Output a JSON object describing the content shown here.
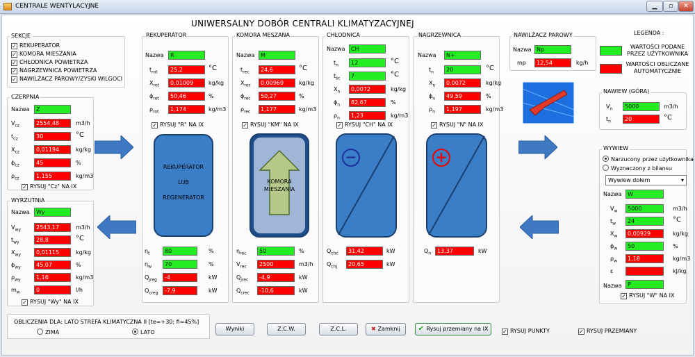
{
  "window": {
    "title": "CENTRALE WENTYLACYJNE",
    "min": "▁",
    "max": "▫",
    "close": "✕"
  },
  "main_title": "UNIWERSALNY DOBÓR CENTRALI KLIMATYZACYJNEJ",
  "sekcje": {
    "title": "SEKCJE",
    "items": [
      "REKUPERATOR",
      "KOMORA MIESZANIA",
      "CHŁODNICA POWIETRZA",
      "NAGRZEWNICA POWIETRZA",
      "NAWILŻACZ PAROWY/ZYSKI WILGOCI"
    ]
  },
  "czerpnia": {
    "title": "CZERPNIA",
    "nazwa_label": "Nazwa",
    "nazwa": "Z",
    "rows": [
      {
        "l": "V",
        "s": "cz",
        "v": "2554,48",
        "u": "m3/h"
      },
      {
        "l": "t",
        "s": "cz",
        "v": "30",
        "u": "°C"
      },
      {
        "l": "X",
        "s": "cz",
        "v": "0,01194",
        "u": "kg/kg"
      },
      {
        "l": "ϕ",
        "s": "cz",
        "v": "45",
        "u": "%"
      },
      {
        "l": "ρ",
        "s": "cz",
        "v": "1,155",
        "u": "kg/m3"
      }
    ],
    "check": "RYSUJ \"Cz\" NA IX"
  },
  "wyrzutnia": {
    "title": "WYRZUTNIA",
    "nazwa_label": "Nazwa",
    "nazwa": "Wy",
    "rows": [
      {
        "l": "V",
        "s": "wy",
        "v": "2543,17",
        "u": "m3/h"
      },
      {
        "l": "t",
        "s": "wy",
        "v": "28,8",
        "u": "°C"
      },
      {
        "l": "X",
        "s": "wy",
        "v": "0,01115",
        "u": "kg/kg"
      },
      {
        "l": "ϕ",
        "s": "wy",
        "v": "45,07",
        "u": "%"
      },
      {
        "l": "ρ",
        "s": "wy",
        "v": "1,16",
        "u": "kg/m3"
      },
      {
        "l": "m",
        "s": "w",
        "v": "0",
        "u": "l/h"
      }
    ],
    "check": "RYSUJ \"Wy\" NA IX"
  },
  "rekuperator": {
    "title": "REKUPERATOR",
    "nazwa_label": "Nazwa",
    "nazwa": "R",
    "rows": [
      {
        "l": "t",
        "s": "rot",
        "v": "25,2",
        "u": "°C"
      },
      {
        "l": "X",
        "s": "rot",
        "v": "0,01009",
        "u": "kg/kg"
      },
      {
        "l": "ϕ",
        "s": "rot",
        "v": "50,46",
        "u": "%"
      },
      {
        "l": "ρ",
        "s": "rot",
        "v": "1,174",
        "u": "kg/m3"
      }
    ],
    "check": "RYSUJ \"R\" NA IX",
    "device": [
      "REKUPERATOR",
      "LUB",
      "REGENERATOR"
    ],
    "bottom": [
      {
        "l": "η",
        "s": "t",
        "v": "80",
        "u": "%",
        "c": "g"
      },
      {
        "l": "η",
        "s": "w",
        "v": "70",
        "u": "%",
        "c": "g"
      },
      {
        "l": "Q",
        "s": "jreg",
        "v": "-4",
        "u": "kW",
        "c": "r"
      },
      {
        "l": "Q",
        "s": "creg",
        "v": "-7,9",
        "u": "kW",
        "c": "r"
      }
    ]
  },
  "komora": {
    "title": "KOMORA MESZANA",
    "nazwa_label": "Nazwa",
    "nazwa": "M",
    "rows": [
      {
        "l": "t",
        "s": "rec",
        "v": "24,6",
        "u": "°C"
      },
      {
        "l": "X",
        "s": "rec",
        "v": "0,00969",
        "u": "kg/kg"
      },
      {
        "l": "ϕ",
        "s": "rec",
        "v": "50,27",
        "u": "%"
      },
      {
        "l": "ρ",
        "s": "rec",
        "v": "1,177",
        "u": "kg/m3"
      }
    ],
    "check": "RYSUJ \"KM\" NA IX",
    "device": [
      "KOMORA",
      "MIESZANIA"
    ],
    "bottom": [
      {
        "l": "η",
        "s": "rec",
        "v": "50",
        "u": "%",
        "c": "g"
      },
      {
        "l": "V",
        "s": "rec",
        "v": "2500",
        "u": "m3/h",
        "c": "r"
      },
      {
        "l": "Q",
        "s": "jrec",
        "v": "-4,9",
        "u": "kW",
        "c": "r"
      },
      {
        "l": "Q",
        "s": "crec",
        "v": "-10,6",
        "u": "kW",
        "c": "r"
      }
    ]
  },
  "chlodnica": {
    "title": "CHŁODNICA",
    "nazwa_label": "Nazwa",
    "nazwa": "CH",
    "rows": [
      {
        "l": "t",
        "s": "n",
        "v": "12",
        "u": "°C",
        "c": "g"
      },
      {
        "l": "t",
        "s": "śc",
        "v": "7",
        "u": "°C",
        "c": "g"
      },
      {
        "l": "X",
        "s": "n",
        "v": "0,0072",
        "u": "kg/kg",
        "c": "r"
      },
      {
        "l": "ϕ",
        "s": "n",
        "v": "82,67",
        "u": "%",
        "c": "r"
      },
      {
        "l": "ρ",
        "s": "n",
        "v": "1,23",
        "u": "kg/m3",
        "c": "r"
      }
    ],
    "check": "RYSUJ \"CH\" NA IX",
    "symbol": "−",
    "bottom": [
      {
        "l": "Q",
        "s": "chc",
        "v": "31,42",
        "u": "kW"
      },
      {
        "l": "Q",
        "s": "chj",
        "v": "20,65",
        "u": "kW"
      }
    ]
  },
  "nagrzewnica": {
    "title": "NAGRZEWNICA",
    "nazwa_label": "Nazwa",
    "nazwa": "N+",
    "rows": [
      {
        "l": "t",
        "s": "n",
        "v": "20",
        "u": "°C",
        "c": "g"
      },
      {
        "l": "X",
        "s": "n",
        "v": "0,0072",
        "u": "kg/kg",
        "c": "r"
      },
      {
        "l": "ϕ",
        "s": "n",
        "v": "49,59",
        "u": "%",
        "c": "r"
      },
      {
        "l": "ρ",
        "s": "n",
        "v": "1,197",
        "u": "kg/m3",
        "c": "r"
      }
    ],
    "check": "RYSUJ \"N\" NA IX",
    "symbol": "+",
    "bottom": [
      {
        "l": "Q",
        "s": "n",
        "v": "13,37",
        "u": "kW"
      }
    ]
  },
  "nawilzacz": {
    "title": "NAWILŻACZ PAROWY",
    "nazwa_label": "Nazwa",
    "nazwa": "Np",
    "mp_label": "mp",
    "mp": "12,54",
    "mp_unit": "kg/h"
  },
  "legenda": {
    "title": "LEGENDA :",
    "green": "WARTOŚCI PODANE PRZEZ UŻYTKOWNIKA",
    "red": "WARTOŚCI OBLICZANE AUTOMATYCZNIE",
    "green_color": "#22ee22",
    "red_color": "#ff0000"
  },
  "nawiew": {
    "title": "NAWIEW (GÓRA)",
    "rows": [
      {
        "l": "V",
        "s": "n",
        "v": "5000",
        "u": "m3/h",
        "c": "g"
      },
      {
        "l": "t",
        "s": "n",
        "v": "20",
        "u": "°C",
        "c": "r"
      }
    ]
  },
  "wywiew": {
    "title": "WYWIEW",
    "radio1": "Narzucony przez użytkownika",
    "radio2": "Wyznaczony z bilansu",
    "select": "Wywiew dołem",
    "nazwa_label": "Nazwa",
    "nazwa": "W",
    "rows": [
      {
        "l": "V",
        "s": "w",
        "v": "5000",
        "u": "m3/h",
        "c": "g"
      },
      {
        "l": "t",
        "s": "w",
        "v": "24",
        "u": "°C",
        "c": "g"
      },
      {
        "l": "X",
        "s": "w",
        "v": "0,00929",
        "u": "kg/kg",
        "c": "r"
      },
      {
        "l": "ϕ",
        "s": "w",
        "v": "50",
        "u": "%",
        "c": "g"
      },
      {
        "l": "ρ",
        "s": "w",
        "v": "1,18",
        "u": "kg/m3",
        "c": "r"
      },
      {
        "l": "ε",
        "s": "",
        "v": "",
        "u": "kJ/kg",
        "c": "r"
      }
    ],
    "nazwa2_label": "Nazwa",
    "nazwa2": "P",
    "check": "RYSUJ \"W\" NA IX"
  },
  "obliczenia": {
    "title": "OBLICZENIA DLA: LATO STREFA KLIMATYCZNA  II   [te=+30; fi=45%]",
    "zima": "ZIMA",
    "lato": "LATO"
  },
  "buttons": {
    "wyniki": "Wyniki",
    "zcw": "Z.C.W.",
    "zcl": "Z.C.L.",
    "zamknij": "Zamknij",
    "rysuj": "Rysuj przemiany na IX"
  },
  "checks_bottom": {
    "punkty": "RYSUJ PUNKTY",
    "przemiany": "RYSUJ PRZEMIANY"
  }
}
